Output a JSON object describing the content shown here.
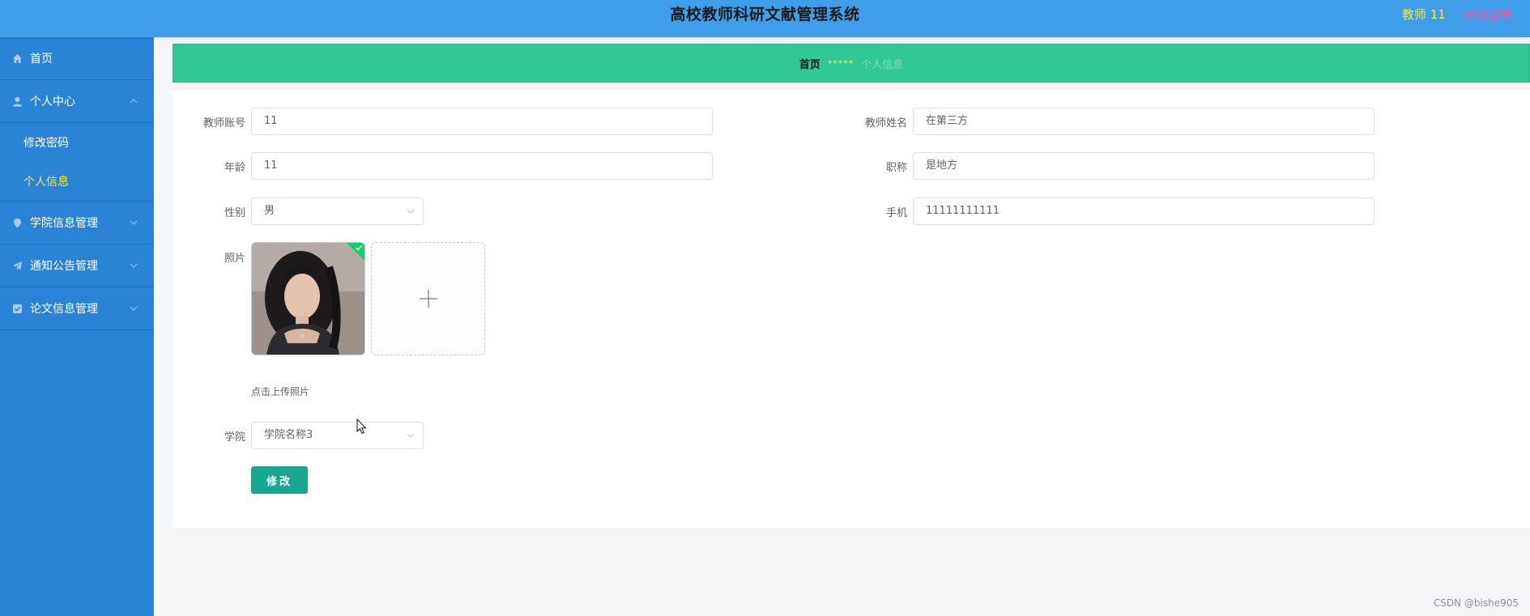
{
  "header": {
    "title": "高校教师科研文献管理系统",
    "user": "教师 11",
    "logout": "退出登录"
  },
  "sidebar": {
    "items": [
      {
        "label": "首页",
        "icon": "home-icon"
      },
      {
        "label": "个人中心",
        "icon": "user-icon",
        "expanded": true,
        "children": [
          {
            "label": "修改密码"
          },
          {
            "label": "个人信息",
            "active": true
          }
        ]
      },
      {
        "label": "学院信息管理",
        "icon": "pin-icon"
      },
      {
        "label": "通知公告管理",
        "icon": "paper-plane-icon"
      },
      {
        "label": "论文信息管理",
        "icon": "checkbox-icon"
      }
    ]
  },
  "breadcrumb": {
    "home": "首页",
    "separator": "*****",
    "current": "个人信息"
  },
  "form": {
    "account_label": "教师账号",
    "account_value": "11",
    "name_label": "教师姓名",
    "name_value": "在第三方",
    "age_label": "年龄",
    "age_value": "11",
    "title_label": "职称",
    "title_value": "是地方",
    "gender_label": "性别",
    "gender_value": "男",
    "phone_label": "手机",
    "phone_value": "11111111111",
    "photo_label": "照片",
    "upload_tip": "点击上传照片",
    "college_label": "学院",
    "college_value": "学院名称3",
    "submit_label": "修改"
  },
  "footer": {
    "watermark": "CSDN @bishe905"
  },
  "colors": {
    "header_bg": "#409ee8",
    "sidebar_bg": "#2b83d6",
    "breadcrumb_bg": "#31c895",
    "active_menu": "#f5e74a",
    "logout": "#e85aa8",
    "submit_bg": "#19a88f"
  }
}
